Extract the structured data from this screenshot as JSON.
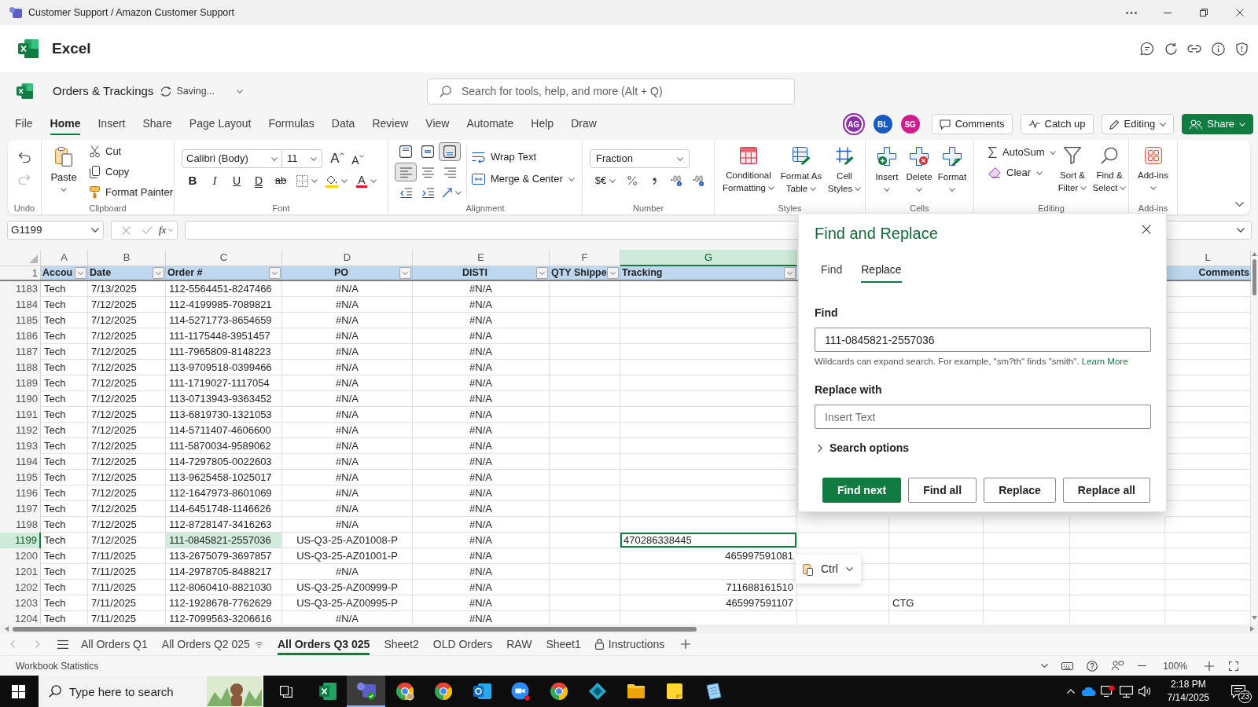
{
  "title_bar": {
    "title": "Customer Support / Amazon Customer Support"
  },
  "app_header": {
    "app_name": "Excel"
  },
  "document_bar": {
    "file_name": "Orders & Trackings",
    "save_status": "Saving...",
    "search_placeholder": "Search for tools, help, and more (Alt + Q)"
  },
  "ribbon_tabs": [
    {
      "label": "File",
      "selected": false
    },
    {
      "label": "Home",
      "selected": true
    },
    {
      "label": "Insert",
      "selected": false
    },
    {
      "label": "Share",
      "selected": false
    },
    {
      "label": "Page Layout",
      "selected": false
    },
    {
      "label": "Formulas",
      "selected": false
    },
    {
      "label": "Data",
      "selected": false
    },
    {
      "label": "Review",
      "selected": false
    },
    {
      "label": "View",
      "selected": false
    },
    {
      "label": "Automate",
      "selected": false
    },
    {
      "label": "Help",
      "selected": false
    },
    {
      "label": "Draw",
      "selected": false
    }
  ],
  "collaborators": [
    {
      "initials": "AG",
      "color": "#8c2fa8",
      "active": true
    },
    {
      "initials": "BL",
      "color": "#185abd",
      "active": false
    },
    {
      "initials": "SG",
      "color": "#d41b8c",
      "active": false
    }
  ],
  "header_buttons": [
    {
      "label": "Comments",
      "kind": "comments"
    },
    {
      "label": "Catch up",
      "kind": "catch_up"
    },
    {
      "label": "Editing",
      "kind": "mode"
    },
    {
      "label": "Share",
      "kind": "share"
    }
  ],
  "ribbon": {
    "undo": {
      "label": "Undo",
      "redo_disabled": true
    },
    "clipboard": {
      "label": "Clipboard",
      "paste": "Paste",
      "cut": "Cut",
      "copy": "Copy",
      "format_painter": "Format Painter"
    },
    "font": {
      "label": "Font",
      "font_name": "Calibri (Body)",
      "font_size": "11",
      "grow": "A",
      "shrink": "A",
      "bold": "B",
      "italic": "I",
      "underline": "U",
      "double_underline": "D",
      "strikethrough": "ab",
      "font_color": "A"
    },
    "alignment": {
      "label": "Alignment",
      "vertical": [
        {
          "selected": false
        },
        {
          "selected": false
        },
        {
          "selected": true
        }
      ],
      "horizontal": [
        {
          "selected": true
        },
        {
          "selected": false
        },
        {
          "selected": false
        }
      ],
      "wrap_text": "Wrap Text",
      "merge_center": "Merge & Center"
    },
    "number": {
      "label": "Number",
      "format": "Fraction",
      "currency": "$€"
    },
    "styles": {
      "label": "Styles",
      "conditional_formatting": "Conditional Formatting",
      "format_as_table": "Format As Table",
      "cell_styles": "Cell Styles"
    },
    "cells": {
      "label": "Cells",
      "insert": "Insert",
      "delete": "Delete",
      "format": "Format"
    },
    "editing": {
      "label": "Editing",
      "autosum": "AutoSum",
      "clear": "Clear",
      "sort_filter": "Sort & Filter",
      "find_select": "Find & Select"
    },
    "addins": {
      "label": "Add-ins",
      "button": "Add-ins"
    }
  },
  "formula_bar": {
    "name_box": "G1199",
    "function_label": "fx",
    "edit_disabled": true
  },
  "sheet": {
    "columns": [
      {
        "letter": "A",
        "selected": false
      },
      {
        "letter": "B",
        "selected": false
      },
      {
        "letter": "C",
        "selected": false
      },
      {
        "letter": "D",
        "selected": false
      },
      {
        "letter": "E",
        "selected": false
      },
      {
        "letter": "F",
        "selected": false
      },
      {
        "letter": "G",
        "selected": true
      },
      null,
      null,
      null,
      null,
      {
        "letter": "L",
        "selected": false
      }
    ],
    "header_row": {
      "number": "1",
      "cells": [
        {
          "text": "Accou",
          "filter": true
        },
        {
          "text": "Date",
          "filter": true
        },
        {
          "text": "Order #",
          "filter": true
        },
        {
          "text": "PO",
          "filter": true
        },
        {
          "text": "DISTI",
          "filter": true
        },
        {
          "text": "QTY Shippe",
          "filter": true
        },
        {
          "text": "Tracking",
          "filter": true
        },
        null,
        null,
        null,
        null,
        {
          "text": "Comments",
          "filter": false
        }
      ]
    },
    "rows": [
      {
        "number": "1183",
        "selected": false,
        "cells": [
          "Tech",
          "7/13/2025",
          "112-5564451-8247466",
          "#N/A",
          "#N/A"
        ]
      },
      {
        "number": "1184",
        "selected": false,
        "cells": [
          "Tech",
          "7/12/2025",
          "112-4199985-7089821",
          "#N/A",
          "#N/A"
        ]
      },
      {
        "number": "1185",
        "selected": false,
        "cells": [
          "Tech",
          "7/12/2025",
          "114-5271773-8654659",
          "#N/A",
          "#N/A"
        ]
      },
      {
        "number": "1186",
        "selected": false,
        "cells": [
          "Tech",
          "7/12/2025",
          "111-1175448-3951457",
          "#N/A",
          "#N/A"
        ]
      },
      {
        "number": "1187",
        "selected": false,
        "cells": [
          "Tech",
          "7/12/2025",
          "111-7965809-8148223",
          "#N/A",
          "#N/A"
        ]
      },
      {
        "number": "1188",
        "selected": false,
        "cells": [
          "Tech",
          "7/12/2025",
          "113-9709518-0399466",
          "#N/A",
          "#N/A"
        ]
      },
      {
        "number": "1189",
        "selected": false,
        "cells": [
          "Tech",
          "7/12/2025",
          "111-1719027-1117054",
          "#N/A",
          "#N/A"
        ]
      },
      {
        "number": "1190",
        "selected": false,
        "cells": [
          "Tech",
          "7/12/2025",
          "113-0713943-9363452",
          "#N/A",
          "#N/A"
        ]
      },
      {
        "number": "1191",
        "selected": false,
        "cells": [
          "Tech",
          "7/12/2025",
          "113-6819730-1321053",
          "#N/A",
          "#N/A"
        ]
      },
      {
        "number": "1192",
        "selected": false,
        "cells": [
          "Tech",
          "7/12/2025",
          "114-5711407-4606600",
          "#N/A",
          "#N/A"
        ]
      },
      {
        "number": "1193",
        "selected": false,
        "cells": [
          "Tech",
          "7/12/2025",
          "111-5870034-9589062",
          "#N/A",
          "#N/A"
        ]
      },
      {
        "number": "1194",
        "selected": false,
        "cells": [
          "Tech",
          "7/12/2025",
          "114-7297805-0022603",
          "#N/A",
          "#N/A"
        ]
      },
      {
        "number": "1195",
        "selected": false,
        "cells": [
          "Tech",
          "7/12/2025",
          "113-9625458-1025017",
          "#N/A",
          "#N/A"
        ]
      },
      {
        "number": "1196",
        "selected": false,
        "cells": [
          "Tech",
          "7/12/2025",
          "112-1647973-8601069",
          "#N/A",
          "#N/A"
        ]
      },
      {
        "number": "1197",
        "selected": false,
        "cells": [
          "Tech",
          "7/12/2025",
          "114-6451748-1146626",
          "#N/A",
          "#N/A"
        ]
      },
      {
        "number": "1198",
        "selected": false,
        "cells": [
          "Tech",
          "7/12/2025",
          "112-8728147-3416263",
          "#N/A",
          "#N/A"
        ]
      },
      {
        "number": "1199",
        "selected": true,
        "cells": [
          "Tech",
          "7/12/2025",
          {
            "text": "111-0845821-2557036",
            "highlighted": true
          },
          "US-Q3-25-AZ01008-P",
          "#N/A",
          null,
          "470286338445"
        ]
      },
      {
        "number": "1200",
        "selected": false,
        "cells": [
          "Tech",
          "7/11/2025",
          "113-2675079-3697857",
          "US-Q3-25-AZ01001-P",
          "#N/A",
          null,
          "465997591081"
        ]
      },
      {
        "number": "1201",
        "selected": false,
        "cells": [
          "Tech",
          "7/11/2025",
          "114-2978705-8488217",
          "#N/A",
          "#N/A"
        ]
      },
      {
        "number": "1202",
        "selected": false,
        "cells": [
          "Tech",
          "7/11/2025",
          "112-8060410-8821030",
          "US-Q3-25-AZ00999-P",
          "#N/A",
          null,
          "711688161510"
        ]
      },
      {
        "number": "1203",
        "selected": false,
        "cells": [
          "Tech",
          "7/11/2025",
          "112-1928678-7762629",
          "US-Q3-25-AZ00995-P",
          "#N/A",
          null,
          "465997591107",
          null,
          "CTG"
        ]
      },
      {
        "number": "1204",
        "selected": false,
        "cells": [
          "Tech",
          "7/11/2025",
          "112-7099563-3206616",
          "#N/A",
          "#N/A"
        ]
      }
    ]
  },
  "find_replace": {
    "title": "Find and Replace",
    "tabs": [
      {
        "label": "Find",
        "selected": false
      },
      {
        "label": "Replace",
        "selected": true
      }
    ],
    "find_label": "Find",
    "find_value": "111-0845821-2557036",
    "hint": "Wildcards can expand search. For example, \"sm?th\" finds \"smith\".",
    "learn_more": "Learn More",
    "replace_label": "Replace with",
    "replace_placeholder": "Insert Text",
    "search_options": {
      "label": "Search options",
      "expanded": false
    },
    "buttons": [
      {
        "label": "Find next",
        "kind": "primary"
      },
      {
        "label": "Find all",
        "kind": "secondary"
      },
      {
        "label": "Replace",
        "kind": "secondary"
      },
      {
        "label": "Replace all",
        "kind": "secondary"
      }
    ]
  },
  "paste_options": {
    "label": "Ctrl"
  },
  "sheet_tabs": [
    {
      "label": "All Orders Q1",
      "selected": false,
      "kind": "plain"
    },
    {
      "label": "All Orders Q2 025",
      "selected": false,
      "kind": "shared"
    },
    {
      "label": "All Orders Q3 025",
      "selected": true,
      "kind": "plain"
    },
    {
      "label": "Sheet2",
      "selected": false,
      "kind": "plain"
    },
    {
      "label": "OLD Orders",
      "selected": false,
      "kind": "plain"
    },
    {
      "label": "RAW",
      "selected": false,
      "kind": "plain"
    },
    {
      "label": "Sheet1",
      "selected": false,
      "kind": "plain"
    },
    {
      "label": "Instructions",
      "selected": false,
      "kind": "protected"
    }
  ],
  "status_bar": {
    "label": "Workbook Statistics",
    "zoom": "100%"
  },
  "taskbar": {
    "search_placeholder": "Type here to search",
    "apps": [
      {
        "active": false
      },
      {
        "active": true
      },
      {
        "active": false
      },
      {
        "active": false
      },
      {
        "active": false
      },
      {
        "active": false
      },
      {
        "active": false
      },
      {
        "active": false
      },
      {
        "active": false
      },
      {
        "active": false
      },
      {
        "active": false
      }
    ],
    "time": "2:18 PM",
    "date": "7/14/2025",
    "notifications": "23"
  }
}
